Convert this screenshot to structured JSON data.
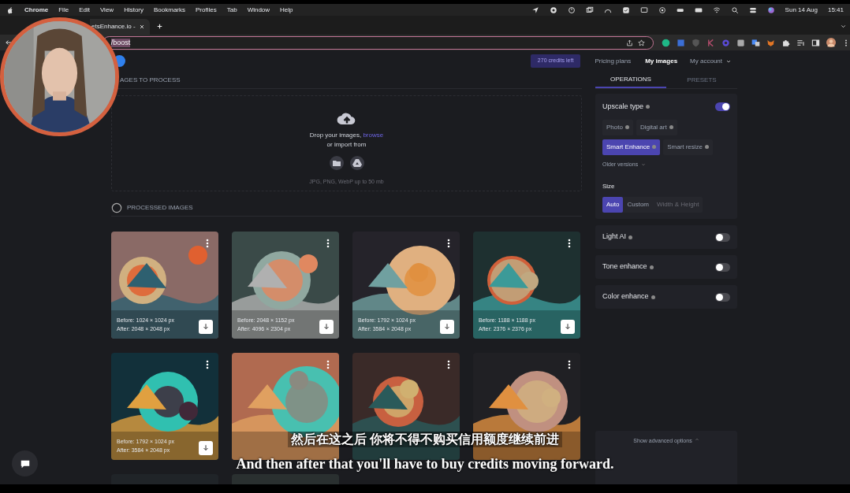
{
  "menu_bar": {
    "app": "Chrome",
    "menus": [
      "File",
      "Edit",
      "View",
      "History",
      "Bookmarks",
      "Profiles",
      "Tab",
      "Window",
      "Help"
    ],
    "date": "Sun 14 Aug",
    "time": "15:41"
  },
  "browser": {
    "tab_title": "etsEnhance.io -",
    "address": "/boost"
  },
  "header": {
    "credits": "270 credits left",
    "nav": [
      {
        "label": "Pricing plans",
        "selected": false
      },
      {
        "label": "My images",
        "selected": true
      }
    ],
    "account": "My account"
  },
  "upload": {
    "heading": "AGES TO PROCESS",
    "prompt": "Drop your images, ",
    "link": "browse",
    "import_text": "or import from",
    "formats": "JPG, PNG, WebP up to 50 mb"
  },
  "processed": {
    "heading": "PROCESSED IMAGES",
    "all_checked": false,
    "images": [
      {
        "kind": "picture",
        "before": "Before: 1024 × 1024 px",
        "after": "After: 2048 × 2048 px"
      },
      {
        "kind": "picture",
        "before": "Before: 2048 × 1152 px",
        "after": "After: 4096 × 2304 px"
      },
      {
        "kind": "picture",
        "before": "Before: 1792 × 1024 px",
        "after": "After: 3584 × 2048 px"
      },
      {
        "kind": "picture",
        "before": "Before: 1188 × 1188 px",
        "after": "After: 2376 × 2376 px"
      },
      {
        "kind": "picture",
        "before": "Before: 1792 × 1024 px",
        "after": "After: 3584 × 2048 px"
      },
      {
        "kind": "picture"
      },
      {
        "kind": "picture"
      },
      {
        "kind": "picture"
      }
    ],
    "more_images": [
      {
        "kind": "picture"
      },
      {
        "kind": "picture"
      }
    ]
  },
  "operations": {
    "tabs": [
      {
        "label": "OPERATIONS",
        "selected": true
      },
      {
        "label": "PRESETS",
        "selected": false
      }
    ],
    "upscale": {
      "label": "Upscale type",
      "on": true,
      "types": [
        {
          "label": "Photo",
          "selected": false
        },
        {
          "label": "Digital art",
          "selected": false
        },
        {
          "label": "Smart Enhance",
          "selected": true
        },
        {
          "label": "Smart resize",
          "selected": false
        }
      ],
      "older": "Older versions"
    },
    "size": {
      "label": "Size",
      "options": [
        {
          "label": "Auto",
          "selected": true,
          "disabled": false
        },
        {
          "label": "Custom",
          "selected": false,
          "disabled": false
        },
        {
          "label": "Width & Height",
          "selected": false,
          "disabled": true
        }
      ]
    },
    "toggles": [
      {
        "label": "Light AI",
        "on": false
      },
      {
        "label": "Tone enhance",
        "on": false
      },
      {
        "label": "Color enhance",
        "on": false
      }
    ],
    "advanced": "Show advanced options"
  },
  "subtitles": {
    "chinese": "然后在这之后 你将不得不购买信用额度继续前进",
    "english": "And then after that you'll have to buy credits moving forward."
  }
}
